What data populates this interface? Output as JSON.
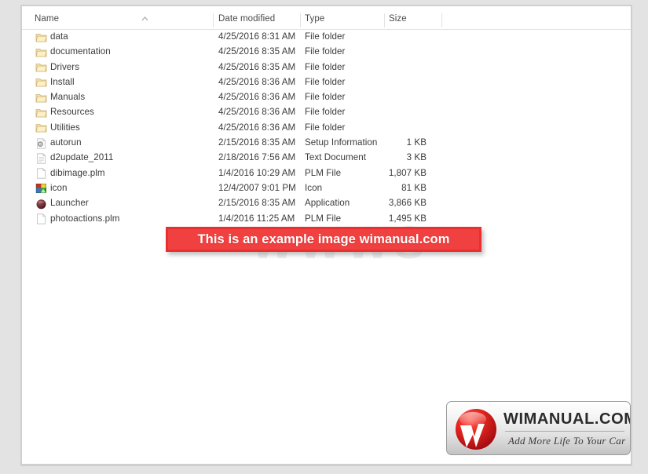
{
  "window": {
    "background_color": "#e3e3e3",
    "panel_color": "#ffffff"
  },
  "columns": [
    {
      "key": "name",
      "label": "Name",
      "sort_indicator": "ascending-chevron"
    },
    {
      "key": "date_modified",
      "label": "Date modified",
      "sort_indicator": "none"
    },
    {
      "key": "type",
      "label": "Type",
      "sort_indicator": "none"
    },
    {
      "key": "size",
      "label": "Size",
      "sort_indicator": "none"
    }
  ],
  "files": [
    {
      "name": "data",
      "date_modified": "4/25/2016 8:31 AM",
      "type": "File folder",
      "size": "",
      "icon": "folder-icon"
    },
    {
      "name": "documentation",
      "date_modified": "4/25/2016 8:35 AM",
      "type": "File folder",
      "size": "",
      "icon": "folder-icon"
    },
    {
      "name": "Drivers",
      "date_modified": "4/25/2016 8:35 AM",
      "type": "File folder",
      "size": "",
      "icon": "folder-icon"
    },
    {
      "name": "Install",
      "date_modified": "4/25/2016 8:36 AM",
      "type": "File folder",
      "size": "",
      "icon": "folder-icon"
    },
    {
      "name": "Manuals",
      "date_modified": "4/25/2016 8:36 AM",
      "type": "File folder",
      "size": "",
      "icon": "folder-icon"
    },
    {
      "name": "Resources",
      "date_modified": "4/25/2016 8:36 AM",
      "type": "File folder",
      "size": "",
      "icon": "folder-icon"
    },
    {
      "name": "Utilities",
      "date_modified": "4/25/2016 8:36 AM",
      "type": "File folder",
      "size": "",
      "icon": "folder-icon"
    },
    {
      "name": "autorun",
      "date_modified": "2/15/2016 8:35 AM",
      "type": "Setup Information",
      "size": "1 KB",
      "icon": "gear-document-icon"
    },
    {
      "name": "d2update_2011",
      "date_modified": "2/18/2016 7:56 AM",
      "type": "Text Document",
      "size": "3 KB",
      "icon": "text-document-icon"
    },
    {
      "name": "dibimage.plm",
      "date_modified": "1/4/2016 10:29 AM",
      "type": "PLM File",
      "size": "1,807 KB",
      "icon": "blank-document-icon"
    },
    {
      "name": "icon",
      "date_modified": "12/4/2007 9:01 PM",
      "type": "Icon",
      "size": "81 KB",
      "icon": "image-icon"
    },
    {
      "name": "Launcher",
      "date_modified": "2/15/2016 8:35 AM",
      "type": "Application",
      "size": "3,866 KB",
      "icon": "application-icon"
    },
    {
      "name": "photoactions.plm",
      "date_modified": "1/4/2016 11:25 AM",
      "type": "PLM File",
      "size": "1,495 KB",
      "icon": "blank-document-icon"
    }
  ],
  "watermark": {
    "text": "WWWS"
  },
  "example_banner": {
    "text": "This is an example image wimanual.com",
    "background_color": "#f04040",
    "border_color": "#e83030",
    "text_color": "#ffffff"
  },
  "logo": {
    "wordmark": "WIMANUAL.COM",
    "tagline": "Add More Life To Your Car",
    "mark_letter": "W",
    "mark_color": "#d81f26"
  }
}
